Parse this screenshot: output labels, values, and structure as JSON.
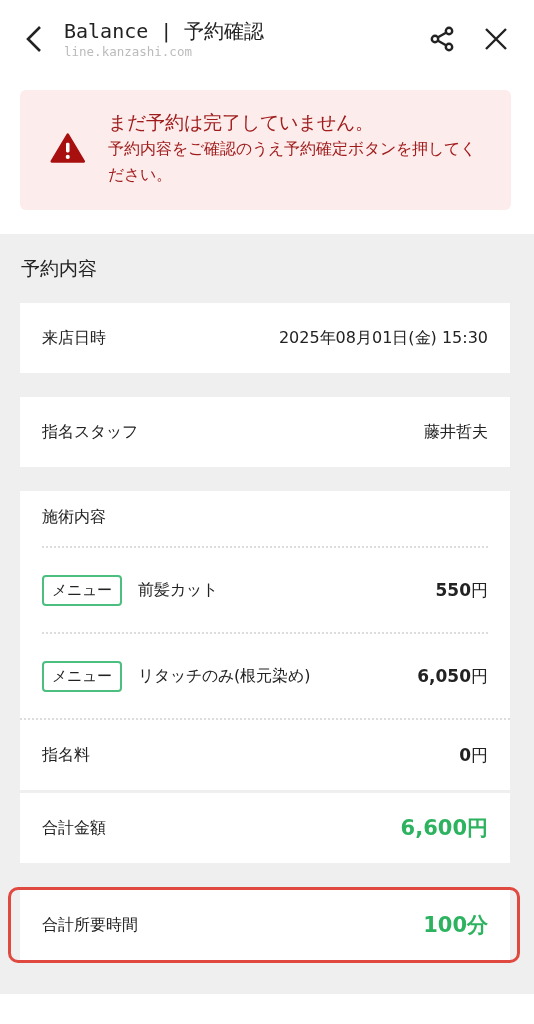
{
  "header": {
    "title": "Balance | 予約確認",
    "url": "line.kanzashi.com"
  },
  "alert": {
    "title": "まだ予約は完了していません。",
    "message": "予約内容をご確認のうえ予約確定ボタンを押してください。"
  },
  "section": {
    "title": "予約内容",
    "cards": [
      {
        "kind": "row",
        "label": "来店日時",
        "value": "2025年08月01日(金) 15:30",
        "emphasis": false,
        "highlighted": false
      },
      {
        "kind": "row",
        "label": "指名スタッフ",
        "value": "藤井哲夫",
        "emphasis": false,
        "highlighted": false
      },
      {
        "kind": "services",
        "label": "施術内容",
        "items": [
          {
            "tag": "メニュー",
            "name": "前髪カット",
            "price": "**550**円"
          },
          {
            "tag": "メニュー",
            "name": "リタッチのみ(根元染め)",
            "price": "**6,050**円"
          }
        ],
        "fee_label": "指名料",
        "fee_value": "**0**円"
      },
      {
        "kind": "row",
        "label": "合計金額",
        "value": "6,600円",
        "emphasis": true,
        "highlighted": false
      },
      {
        "kind": "row",
        "label": "合計所要時間",
        "value": "100分",
        "emphasis": true,
        "highlighted": true
      }
    ]
  }
}
